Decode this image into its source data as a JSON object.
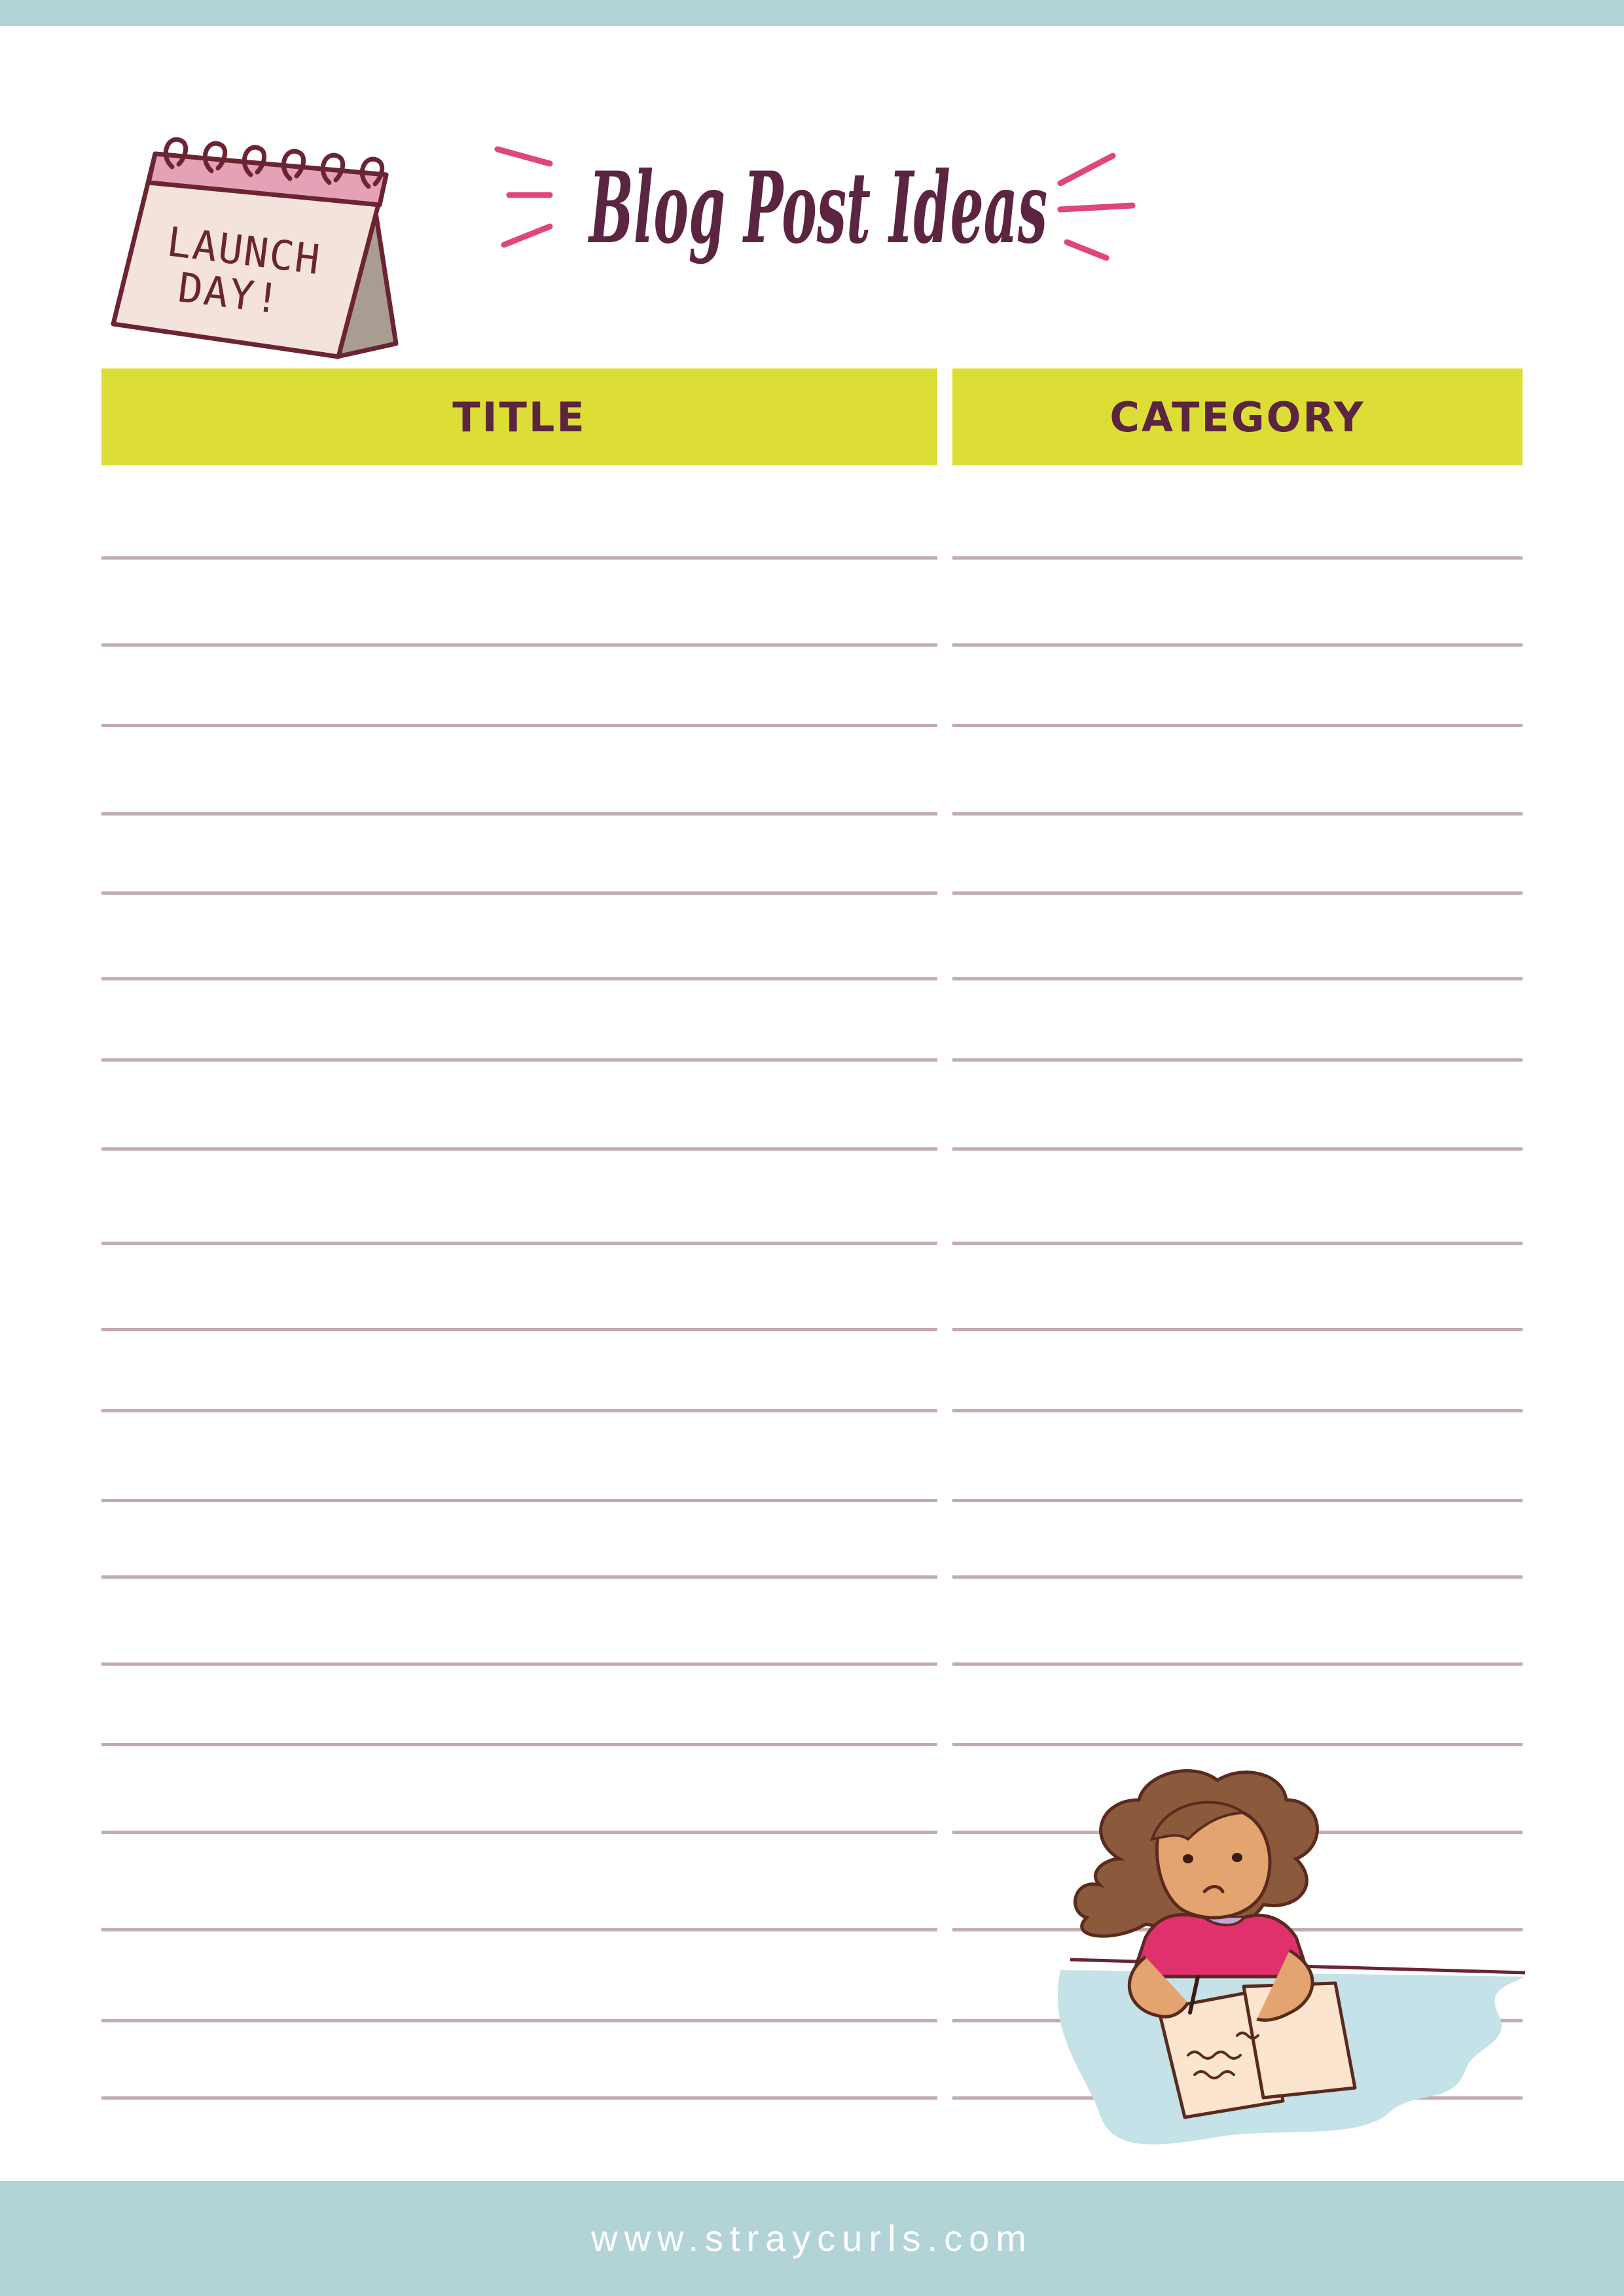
{
  "page": {
    "title": "Blog Post Ideas",
    "calendar_text": "LAUNCH DAY!",
    "footer_url": "www.straycurls.com"
  },
  "table": {
    "columns": [
      "TITLE",
      "CATEGORY"
    ],
    "rows": [
      "",
      "",
      "",
      "",
      "",
      "",
      "",
      "",
      "",
      "",
      "",
      "",
      "",
      "",
      "",
      "",
      "",
      "",
      "",
      ""
    ]
  },
  "colors": {
    "header_fill": "#dcdd35",
    "header_text": "#5b2440",
    "rule_line": "#c2acae",
    "band": "#b3d4d7",
    "title_script": "#5b2440",
    "accent_pink": "#e0457b"
  }
}
